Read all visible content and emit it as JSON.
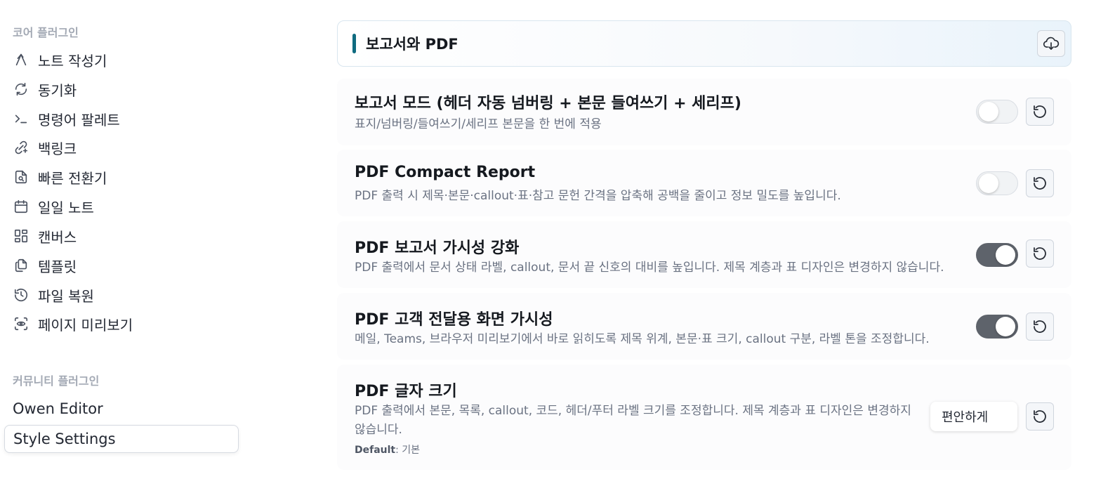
{
  "sidebar": {
    "core_title": "코어 플러그인",
    "core_items": [
      {
        "label": "노트 작성기",
        "icon": "compose-icon"
      },
      {
        "label": "동기화",
        "icon": "sync-icon"
      },
      {
        "label": "명령어 팔레트",
        "icon": "terminal-icon"
      },
      {
        "label": "백링크",
        "icon": "backlink-icon"
      },
      {
        "label": "빠른 전환기",
        "icon": "file-search-icon"
      },
      {
        "label": "일일 노트",
        "icon": "calendar-icon"
      },
      {
        "label": "캔버스",
        "icon": "layout-dashboard-icon"
      },
      {
        "label": "템플릿",
        "icon": "files-icon"
      },
      {
        "label": "파일 복원",
        "icon": "history-icon"
      },
      {
        "label": "페이지 미리보기",
        "icon": "scan-eye-icon"
      }
    ],
    "community_title": "커뮤니티 플러그인",
    "community_items": [
      {
        "label": "Owen Editor"
      },
      {
        "label": "Style Settings"
      }
    ]
  },
  "main": {
    "group_title": "보고서와 PDF",
    "settings": [
      {
        "name": "보고서 모드 (헤더 자동 넘버링 + 본문 들여쓰기 + 세리프)",
        "desc": "표지/넘버링/들여쓰기/세리프 본문을 한 번에 적용",
        "enabled": false
      },
      {
        "name": "PDF Compact Report",
        "desc": "PDF 출력 시 제목·본문·callout·표·참고 문헌 간격을 압축해 공백을 줄이고 정보 밀도를 높입니다.",
        "enabled": false
      },
      {
        "name": "PDF 보고서 가시성 강화",
        "desc": "PDF 출력에서 문서 상태 라벨, callout, 문서 끝 신호의 대비를 높입니다. 제목 계층과 표 디자인은 변경하지 않습니다.",
        "enabled": true
      },
      {
        "name": "PDF 고객 전달용 화면 가시성",
        "desc": "메일, Teams, 브라우저 미리보기에서 바로 읽히도록 제목 위계, 본문·표 크기, callout 구분, 라벨 톤을 조정합니다.",
        "enabled": true
      },
      {
        "name": "PDF 글자 크기",
        "desc": "PDF 출력에서 본문, 목록, callout, 코드, 헤더/푸터 라벨 크기를 조정합니다. 제목 계층과 표 디자인은 변경하지 않습니다.",
        "default_label": "Default",
        "default_value": ": 기본",
        "selected": "편안하게"
      }
    ]
  },
  "colors": {
    "accent": "#0f6b80",
    "toggle_on": "#5e636b",
    "muted_text": "#6a7282"
  }
}
